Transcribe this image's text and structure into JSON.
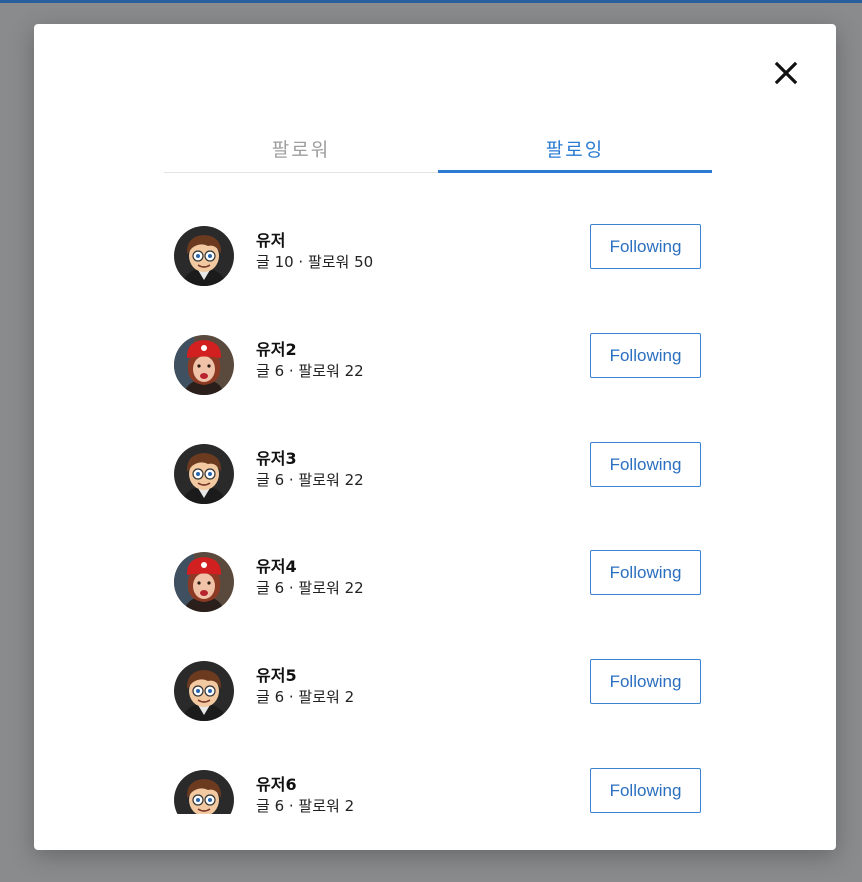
{
  "tabs": [
    {
      "label": "팔로워",
      "active": false
    },
    {
      "label": "팔로잉",
      "active": true
    }
  ],
  "colors": {
    "accent": "#2b7bd3",
    "overlay": "#8a8b8d",
    "inactive_tab": "#9e9e9e"
  },
  "close_icon": "close-icon",
  "users": [
    {
      "name": "유저",
      "stats": "글 10 · 팔로워 50",
      "button": "Following",
      "avatar": "boy-cartoon"
    },
    {
      "name": "유저2",
      "stats": "글 6 · 팔로워 22",
      "button": "Following",
      "avatar": "woman-red-hat"
    },
    {
      "name": "유저3",
      "stats": "글 6 · 팔로워 22",
      "button": "Following",
      "avatar": "boy-cartoon"
    },
    {
      "name": "유저4",
      "stats": "글 6 · 팔로워 22",
      "button": "Following",
      "avatar": "woman-red-hat"
    },
    {
      "name": "유저5",
      "stats": "글 6 · 팔로워 2",
      "button": "Following",
      "avatar": "boy-cartoon"
    },
    {
      "name": "유저6",
      "stats": "글 6 · 팔로워 2",
      "button": "Following",
      "avatar": "boy-cartoon"
    }
  ]
}
